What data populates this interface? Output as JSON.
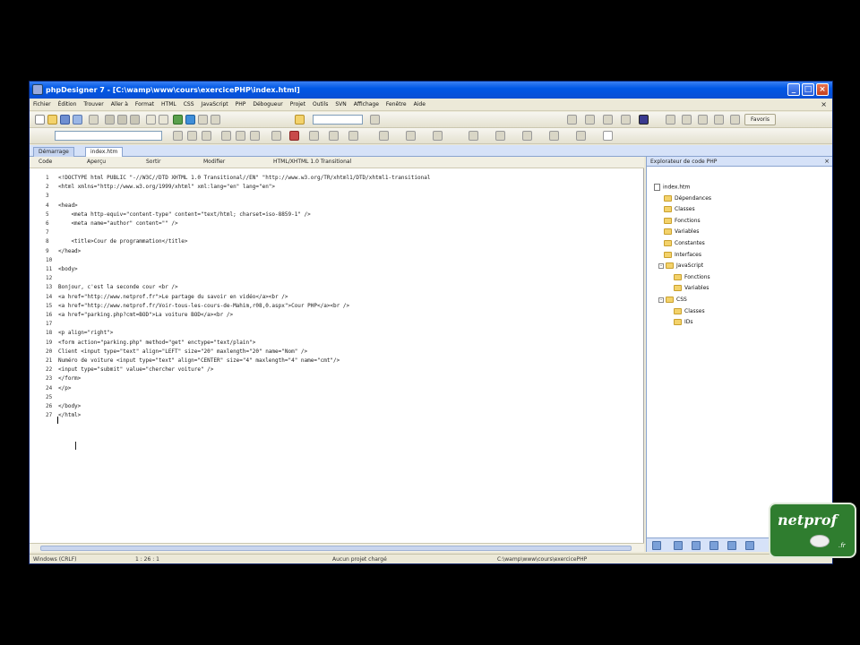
{
  "window": {
    "title": "phpDesigner 7 - [C:\\wamp\\www\\cours\\exercicePHP\\index.html]"
  },
  "menu": [
    "Fichier",
    "Édition",
    "Trouver",
    "Aller à",
    "Format",
    "HTML",
    "CSS",
    "JavaScript",
    "PHP",
    "Débogueur",
    "Projet",
    "Outils",
    "SVN",
    "Affichage",
    "Fenêtre",
    "Aide"
  ],
  "toolbar": {
    "favorites_label": "Favoris"
  },
  "tabs": [
    "Démarrage",
    "index.htm"
  ],
  "editor_toolbar": [
    "Code",
    "Aperçu",
    "Sortir",
    "Modifier",
    "HTML/XHTML 1.0 Transitional"
  ],
  "code": {
    "lines": [
      {
        "n": "1",
        "t": "<!DOCTYPE html PUBLIC \"-//W3C//DTD XHTML 1.0 Transitional//EN\" \"http://www.w3.org/TR/xhtml1/DTD/xhtml1-transitional"
      },
      {
        "n": "2",
        "t": "<html xmlns=\"http://www.w3.org/1999/xhtml\" xml:lang=\"en\" lang=\"en\">"
      },
      {
        "n": "3",
        "t": ""
      },
      {
        "n": "4",
        "t": "<head>"
      },
      {
        "n": "5",
        "t": "    <meta http-equiv=\"content-type\" content=\"text/html; charset=iso-8859-1\" />"
      },
      {
        "n": "6",
        "t": "    <meta name=\"author\" content=\"\" />"
      },
      {
        "n": "7",
        "t": ""
      },
      {
        "n": "8",
        "t": "    <title>Cour de programmation</title>"
      },
      {
        "n": "9",
        "t": "</head>"
      },
      {
        "n": "10",
        "t": ""
      },
      {
        "n": "11",
        "t": "<body>"
      },
      {
        "n": "12",
        "t": ""
      },
      {
        "n": "13",
        "t": "Bonjour, c'est la seconde cour <br />"
      },
      {
        "n": "14",
        "t": "<a href=\"http://www.netprof.fr\">Le partage du savoir en vidéo</a><br />"
      },
      {
        "n": "15",
        "t": "<a href=\"http://www.netprof.fr/Voir-tous-les-cours-de-Mahim,r08,0.aspx\">Cour PHP</a><br />"
      },
      {
        "n": "16",
        "t": "<a href=\"parking.php?cmt=BOD\">La voiture BOD</a><br />"
      },
      {
        "n": "17",
        "t": ""
      },
      {
        "n": "18",
        "t": "<p align=\"right\">"
      },
      {
        "n": "19",
        "t": "<form action=\"parking.php\" method=\"get\" enctype=\"text/plain\">"
      },
      {
        "n": "20",
        "t": "Client <input type=\"text\" align=\"LEFT\" size=\"20\" maxlength=\"20\" name=\"Nom\" />"
      },
      {
        "n": "21",
        "t": "Numéro de voiture <input type=\"text\" align=\"CENTER\" size=\"4\" maxlength=\"4\" name=\"cmt\"/>"
      },
      {
        "n": "22",
        "t": "<input type=\"submit\" value=\"chercher voiture\" />"
      },
      {
        "n": "23",
        "t": "</form>"
      },
      {
        "n": "24",
        "t": "</p>"
      },
      {
        "n": "25",
        "t": ""
      },
      {
        "n": "26",
        "t": "</body>"
      },
      {
        "n": "27",
        "t": "</html>"
      }
    ]
  },
  "side_panel": {
    "title": "Explorateur de code PHP",
    "tree": [
      {
        "label": "index.htm",
        "icon": "doc-icon",
        "level": 0
      },
      {
        "label": "Dépendances",
        "icon": "folder-icon",
        "level": 1
      },
      {
        "label": "Classes",
        "icon": "folder-icon",
        "level": 1
      },
      {
        "label": "Fonctions",
        "icon": "folder-icon",
        "level": 1
      },
      {
        "label": "Variables",
        "icon": "folder-icon",
        "level": 1
      },
      {
        "label": "Constantes",
        "icon": "folder-icon",
        "level": 1
      },
      {
        "label": "Interfaces",
        "icon": "folder-icon",
        "level": 1
      },
      {
        "label": "JavaScript",
        "icon": "folder-icon",
        "level": 1,
        "expander": "-"
      },
      {
        "label": "Fonctions",
        "icon": "folder-icon",
        "level": 2
      },
      {
        "label": "Variables",
        "icon": "folder-icon",
        "level": 2
      },
      {
        "label": "CSS",
        "icon": "folder-icon",
        "level": 1,
        "expander": "-"
      },
      {
        "label": "Classes",
        "icon": "folder-icon",
        "level": 2
      },
      {
        "label": "IDs",
        "icon": "folder-icon",
        "level": 2
      }
    ]
  },
  "status": {
    "mode": "Windows (CRLF)",
    "position": "1 : 26 : 1",
    "message": "Aucun projet chargé",
    "extra": "C:\\wamp\\www\\cours\\exercicePHP"
  },
  "logo": {
    "text": "netprof",
    "suffix": ".fr"
  }
}
